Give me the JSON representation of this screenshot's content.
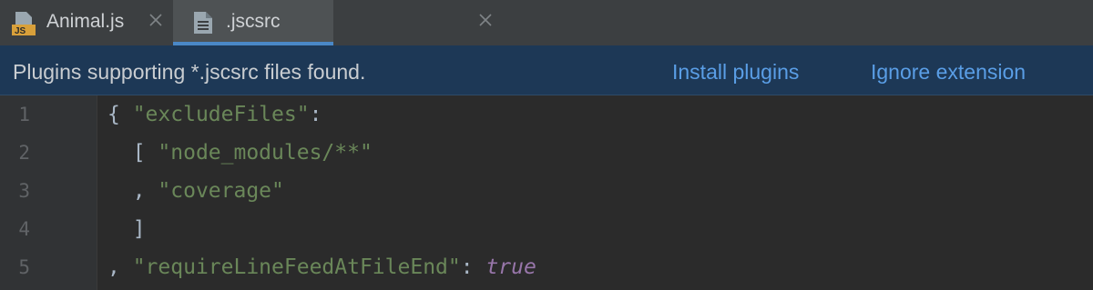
{
  "tabs": [
    {
      "label": "Animal.js",
      "icon": "javascript-file-icon",
      "active": false
    },
    {
      "label": ".jscsrc",
      "icon": "text-file-icon",
      "active": true
    }
  ],
  "js_icon_text": "JS",
  "banner": {
    "message": "Plugins supporting *.jscsrc files found.",
    "install_label": "Install plugins",
    "ignore_label": "Ignore extension"
  },
  "editor": {
    "line_numbers": [
      "1",
      "2",
      "3",
      "4",
      "5"
    ],
    "lines": [
      {
        "indent": "",
        "open": "{ ",
        "string": "\"excludeFiles\"",
        "after": ":",
        "keyword": ""
      },
      {
        "indent": "  ",
        "open": "[ ",
        "string": "\"node_modules/**\"",
        "after": "",
        "keyword": ""
      },
      {
        "indent": "  ",
        "open": ", ",
        "string": "\"coverage\"",
        "after": "",
        "keyword": ""
      },
      {
        "indent": "  ",
        "open": "]",
        "string": "",
        "after": "",
        "keyword": ""
      },
      {
        "indent": "",
        "open": ", ",
        "string": "\"requireLineFeedAtFileEnd\"",
        "after": ": ",
        "keyword": "true"
      }
    ]
  },
  "colors": {
    "accent": "#4a88c7",
    "banner_bg": "#1d3856",
    "link": "#5a9ee6",
    "string": "#6a8759",
    "keyword": "#9876aa",
    "editor_bg": "#2b2b2b"
  }
}
